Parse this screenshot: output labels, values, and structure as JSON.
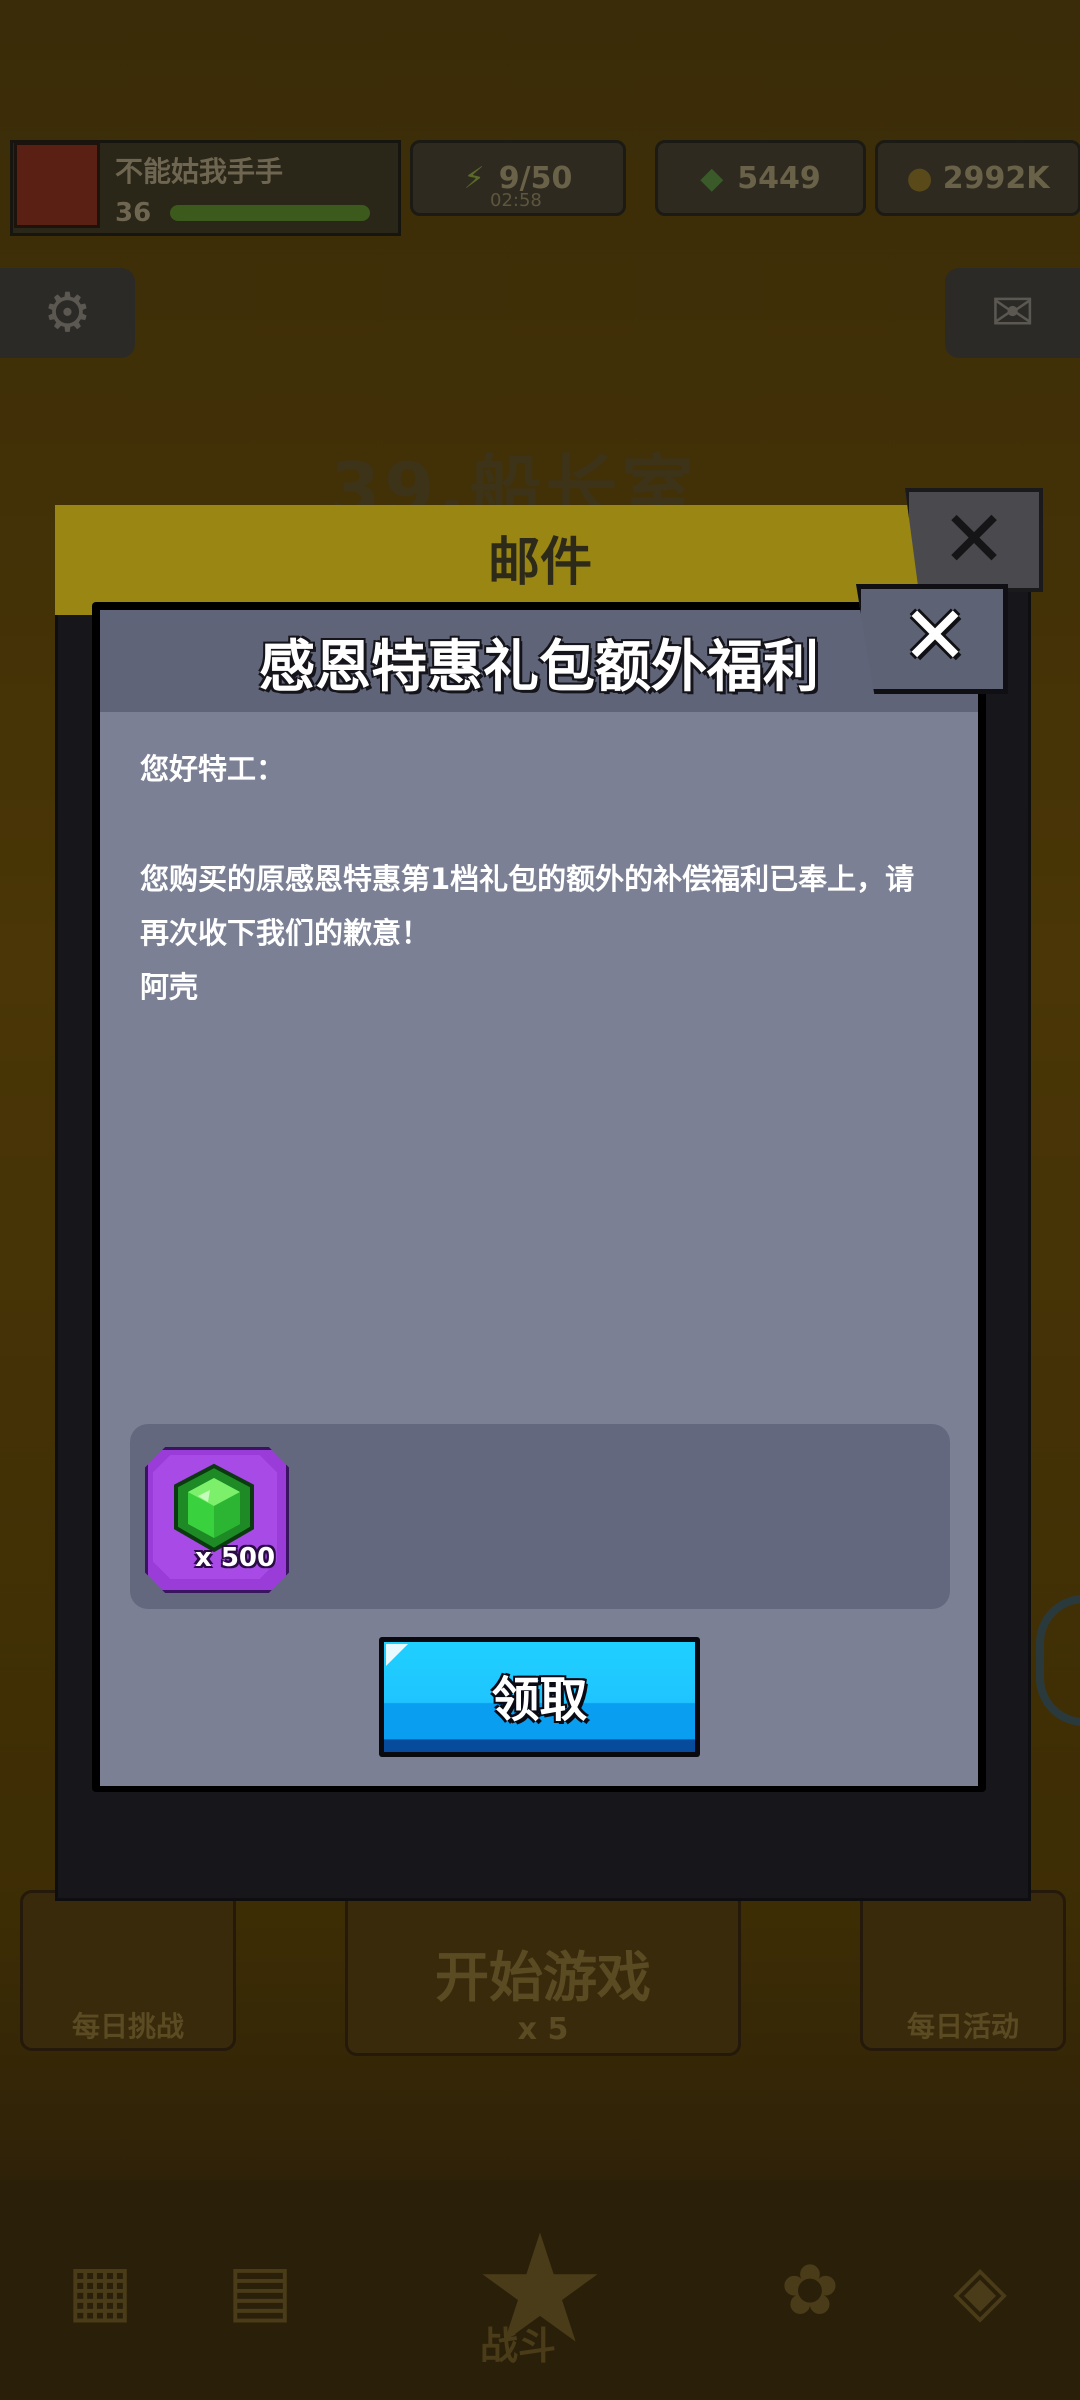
{
  "background": {
    "player": {
      "name": "不能姑我手手",
      "level": "36"
    },
    "resources": {
      "energy": "9/50",
      "energy_sub": "02:58",
      "gems": "5449",
      "coins": "2992K"
    },
    "stage_title": "39.船长室",
    "bottom": {
      "daily_challenge": "每日挑战",
      "start_game": "开始游戏",
      "start_cost": "x 5",
      "daily_event": "每日活动",
      "battle": "战斗"
    }
  },
  "mail_panel": {
    "title": "邮件"
  },
  "dialog": {
    "title": "感恩特惠礼包额外福利",
    "greeting": "您好特工：",
    "body_line1": "您购买的原感恩特惠第1档礼包的额外的补偿福利已奉上，请",
    "body_line2": "再次收下我们的歉意！",
    "signature": "阿壳",
    "reward": {
      "icon": "green-gem-icon",
      "quantity": "x 500"
    },
    "claim_button": "领取"
  },
  "colors": {
    "dialog_body": "#7b8094",
    "dialog_header": "#5f6478",
    "reward_box": "#63687f",
    "claim_button": "#1fc4ff",
    "gem_tile": "#9a3cd8",
    "gem": "#33c83a"
  }
}
